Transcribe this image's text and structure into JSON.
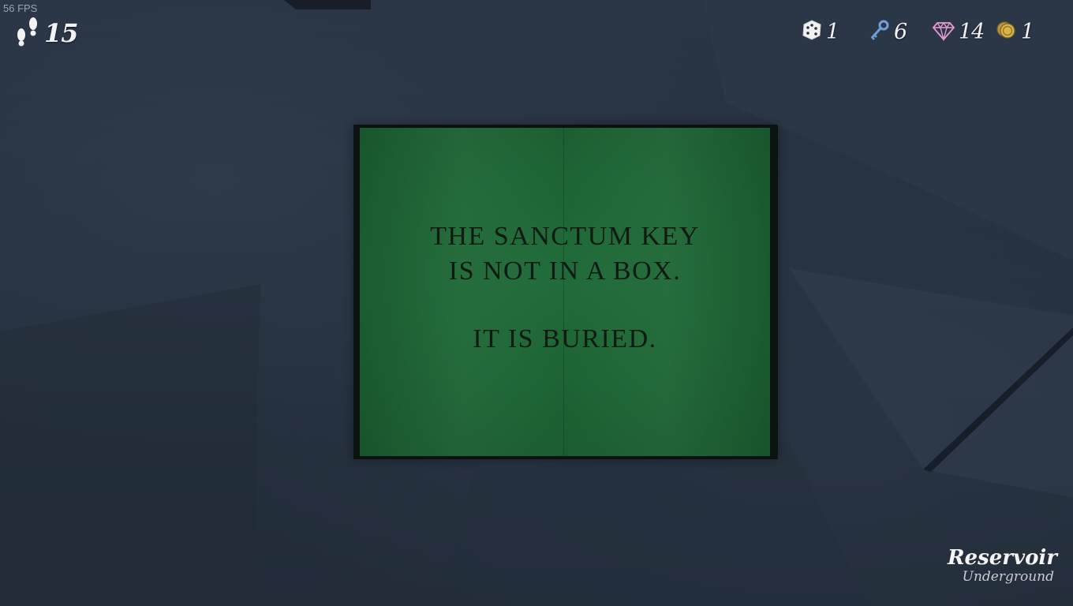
{
  "fps": "56 FPS",
  "hud": {
    "steps": {
      "icon": "footprints-icon",
      "value": "15"
    },
    "dice": {
      "icon": "dice-icon",
      "value": "1",
      "color": "#f2f2f2"
    },
    "keys": {
      "icon": "key-icon",
      "value": "6",
      "color": "#6f9fd8"
    },
    "gems": {
      "icon": "gem-icon",
      "value": "14",
      "color": "#e79ad0"
    },
    "coins": {
      "icon": "coins-icon",
      "value": "1",
      "color": "#d8b44a"
    }
  },
  "note": {
    "line1": "THE SANCTUM KEY",
    "line2": "IS NOT IN A BOX.",
    "line3": "IT IS BURIED.",
    "color": "#1f6a37"
  },
  "logo": {
    "title": "Reservoir",
    "subtitle": "Underground"
  }
}
